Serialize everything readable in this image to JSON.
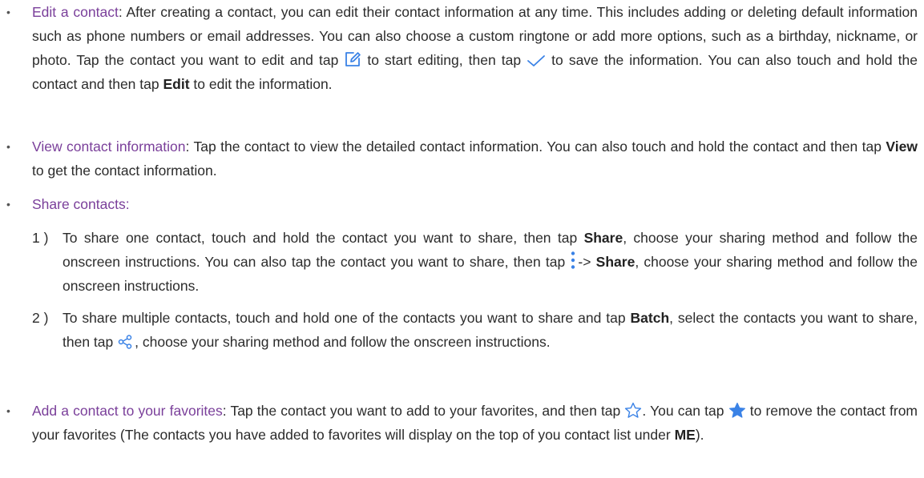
{
  "items": [
    {
      "term": "Edit a contact",
      "t1": ": After creating a contact, you can edit their contact information at any time. This includes adding or deleting default information such as phone numbers or email addresses. You can also choose a custom ringtone or add more options, such as a birthday, nickname, or photo. Tap the contact you want to edit and tap ",
      "t2": " to start editing, then tap ",
      "t3": " to save the information. You can also touch and hold the contact and then tap ",
      "bold": "Edit",
      "t4": " to edit the information."
    },
    {
      "term": "View contact information",
      "t1": ": Tap the contact to view the detailed contact information. You can also touch and hold the contact and then tap ",
      "bold": "View",
      "t2": " to get the contact information."
    },
    {
      "term": "Share contacts:",
      "sub": [
        {
          "num": "1 )",
          "t1": "To share one contact, touch and hold the contact you want to share, then tap ",
          "b1": "Share",
          "t2": ", choose your sharing method and follow the onscreen instructions. You can also tap the contact you want to share, then tap ",
          "t3": "-> ",
          "b2": "Share",
          "t4": ", choose your sharing method and follow the onscreen instructions."
        },
        {
          "num": "2 )",
          "t1": "To share multiple contacts, touch and hold one of the contacts you want to share and tap ",
          "b1": "Batch",
          "t2": ", select the contacts you want to share, then tap ",
          "t3": ", choose your sharing method and follow the onscreen instructions."
        }
      ]
    },
    {
      "term": "Add a contact to your favorites",
      "t1": ": Tap the contact you want to add to your favorites, and then tap ",
      "t2": ". You can tap ",
      "t3": " to remove the contact from your favorites (The contacts you have added to favorites will display on the top of you contact list under ",
      "bold": "ME",
      "t4": ")."
    }
  ],
  "bullet": "•",
  "colors": {
    "term": "#7a3f9a",
    "icon": "#3a82e6",
    "text": "#2b2b2b"
  },
  "icons": [
    "edit-icon",
    "check-icon",
    "more-vertical-icon",
    "share-icon",
    "star-outline-icon",
    "star-filled-icon"
  ]
}
